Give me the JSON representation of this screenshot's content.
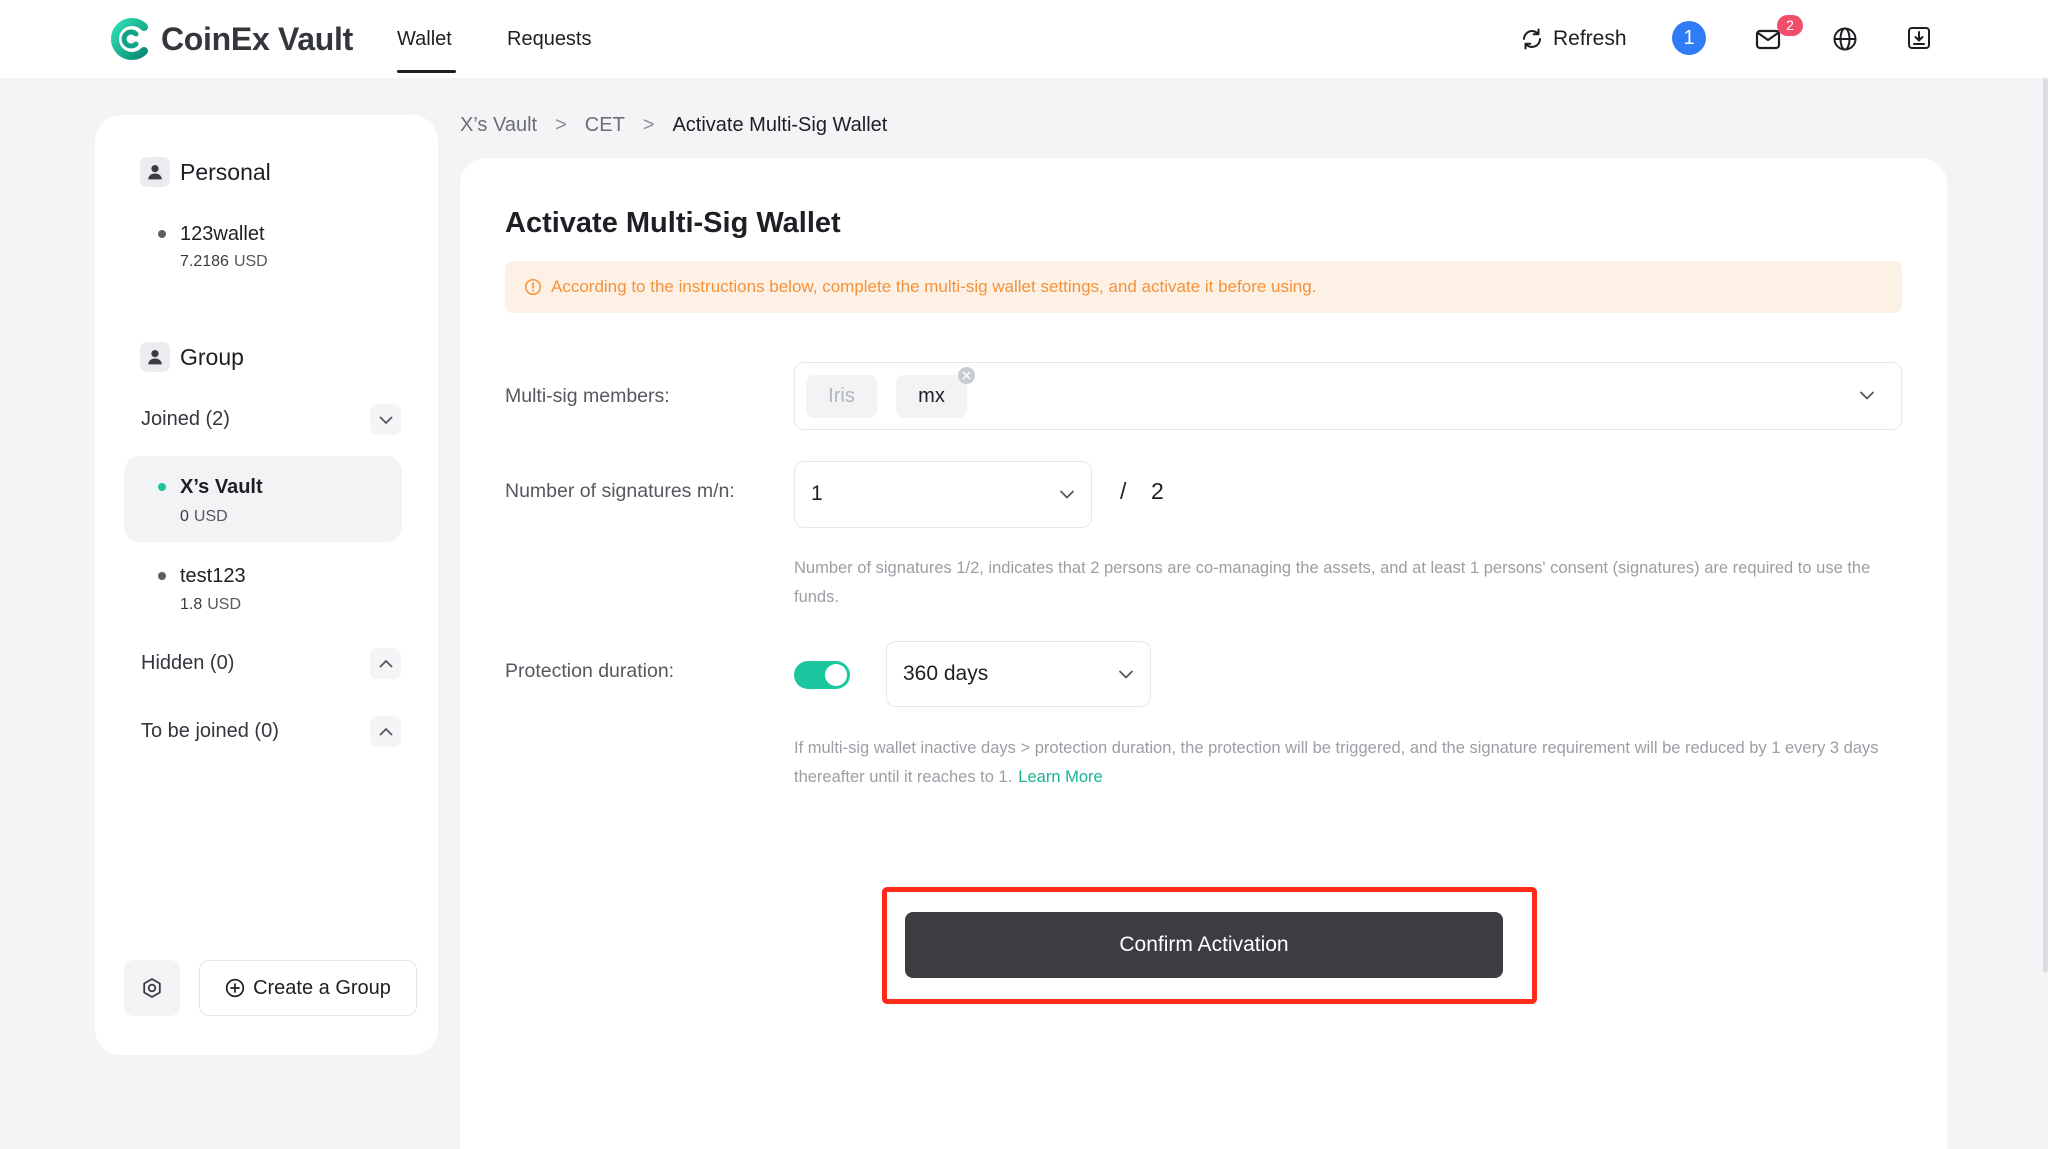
{
  "app": {
    "logo_text": "CoinEx Vault"
  },
  "nav": {
    "tabs": [
      {
        "label": "Wallet",
        "active": true
      },
      {
        "label": "Requests",
        "active": false
      }
    ]
  },
  "header": {
    "refresh_label": "Refresh",
    "account_badge": "1",
    "mail_count": "2",
    "icons": [
      "refresh-icon",
      "mail-icon",
      "globe-icon",
      "download-icon"
    ]
  },
  "sidebar": {
    "personal": {
      "title": "Personal",
      "wallets": [
        {
          "name": "123wallet",
          "amount": "7.2186",
          "unit": "USD"
        }
      ]
    },
    "group": {
      "title": "Group",
      "joined": {
        "label": "Joined (2)",
        "expanded": true,
        "wallets": [
          {
            "name": "X’s Vault",
            "amount": "0",
            "unit": "USD",
            "selected": true
          },
          {
            "name": "test123",
            "amount": "1.8",
            "unit": "USD",
            "selected": false
          }
        ]
      },
      "hidden": {
        "label": "Hidden (0)",
        "expanded": false
      },
      "to_be_joined": {
        "label": "To be joined (0)",
        "expanded": false
      }
    },
    "create_group_label": "Create a Group"
  },
  "breadcrumb": {
    "items": [
      "X’s Vault",
      "CET",
      "Activate Multi-Sig Wallet"
    ],
    "separator": ">"
  },
  "main": {
    "title": "Activate Multi-Sig Wallet",
    "alert": "According to the instructions below, complete the multi-sig wallet settings, and activate it before using.",
    "members": {
      "label": "Multi-sig members:",
      "chips": [
        {
          "name": "Iris",
          "removable": false
        },
        {
          "name": "mx",
          "removable": true
        }
      ]
    },
    "signatures": {
      "label": "Number of signatures m/n:",
      "m": "1",
      "separator": "/",
      "n": "2",
      "help": "Number of signatures 1/2, indicates that 2 persons are co-managing the assets, and at least 1 persons' consent (signatures) are required to use the funds."
    },
    "protection": {
      "label": "Protection duration:",
      "enabled": true,
      "value": "360 days",
      "help": "If multi-sig wallet inactive days > protection duration, the protection will be triggered, and the signature requirement will be reduced by 1 every 3 days thereafter until it reaches to 1.",
      "learn_more": "Learn More"
    },
    "confirm_label": "Confirm Activation"
  },
  "colors": {
    "accent": "#1cc7a0",
    "link": "#19b394",
    "primary_button": "#3b3d42",
    "alert_bg": "#fdf1e6",
    "alert_text": "#f5923a",
    "highlight": "#ff2a1a",
    "mail_badge": "#f04e6a",
    "account_badge": "#2f7cf6"
  }
}
